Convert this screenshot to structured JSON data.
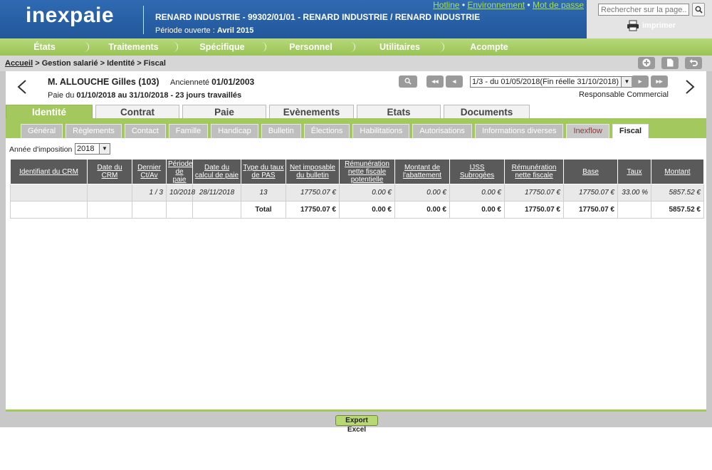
{
  "header": {
    "logo": "inexpaie",
    "company": "RENARD INDUSTRIE - 99302/01/01 - RENARD INDUSTRIE / RENARD INDUSTRIE",
    "period_label": "Période ouverte : ",
    "period_value": "Avril 2015",
    "links": {
      "hotline": "Hotline",
      "sep1": " • ",
      "environment": "Environnement",
      "sep2": " • ",
      "password": "Mot de passe"
    },
    "search_placeholder": "Rechercher sur la page...",
    "print_label": "imprimer"
  },
  "menu": [
    "États",
    "Traitements",
    "Spécifique",
    "Personnel",
    "Utilitaires",
    "Acompte"
  ],
  "breadcrumb": {
    "home": "Accueil",
    "sep": " > ",
    "items": [
      "Gestion salarié",
      "Identité",
      "Fiscal"
    ]
  },
  "employee": {
    "name": "M. ALLOUCHE Gilles (103)",
    "seniority_label": "Ancienneté ",
    "seniority_date": "01/01/2003",
    "pay_prefix": "Paie du ",
    "pay_range": "01/10/2018 au 31/10/2018 - 23 jours travaillés",
    "period_select": "1/3 - du 01/05/2018(Fin réelle 31/10/2018)",
    "job_title": "Responsable Commercial"
  },
  "main_tabs": [
    "Identité",
    "Contrat",
    "Paie",
    "Evènements",
    "Etats",
    "Documents"
  ],
  "sub_tabs": [
    "Général",
    "Règlements",
    "Contact",
    "Famille",
    "Handicap",
    "Bulletin",
    "Élections",
    "Habilitations",
    "Autorisations",
    "Informations diverses",
    "Inexflow",
    "Fiscal"
  ],
  "year_filter": {
    "label": "Année d'imposition :",
    "value": "2018"
  },
  "table": {
    "headers": [
      "Identifiant du CRM",
      "Date du CRM",
      "Dernier Ct/Av",
      "Période de paie",
      "Date du calcul de paie",
      "Type du taux de PAS",
      "Net imposable du bulletin",
      "Rémunération nette fiscale potentielle",
      "Montant de l'abattement",
      "IJSS Subrogées",
      "Rémunération nette fiscale",
      "Base",
      "Taux",
      "Montant"
    ],
    "rows": [
      [
        "",
        "",
        "1 / 3",
        "10/2018",
        "28/11/2018",
        "13",
        "17750.07 €",
        "0.00 €",
        "0.00 €",
        "0.00 €",
        "17750.07 €",
        "17750.07 €",
        "33.00 %",
        "5857.52 €"
      ]
    ],
    "total": [
      "",
      "",
      "",
      "",
      "",
      "Total",
      "17750.07 €",
      "0.00 €",
      "0.00 €",
      "0.00 €",
      "17750.07 €",
      "17750.07 €",
      "",
      "5857.52 €"
    ]
  },
  "footer": {
    "export_label": "Export Excel"
  },
  "colors": {
    "header_blue": "#2a62a8",
    "menu_green": "#a3c95e",
    "link_green": "#a8e04a",
    "table_header": "#5a5a5a"
  },
  "icons": [
    "search-icon",
    "printer-icon",
    "add-icon",
    "document-icon",
    "undo-icon",
    "first-page-icon",
    "prev-page-icon",
    "next-page-icon",
    "last-page-icon",
    "chevron-left-icon",
    "chevron-right-icon"
  ]
}
